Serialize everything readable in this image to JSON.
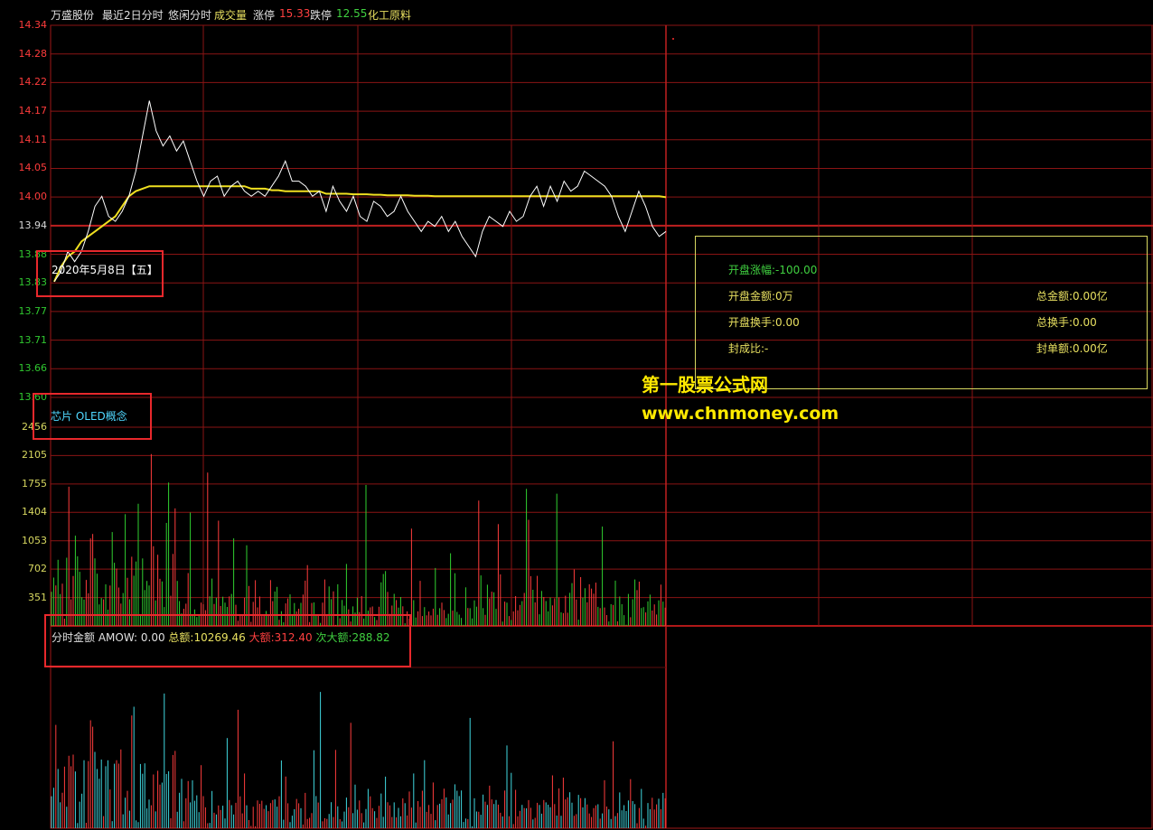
{
  "header": {
    "stock_name": "万盛股份",
    "mode": "最近2日分时",
    "mode2": "悠闲分时",
    "volume_label": "成交量",
    "limit_up_label": "涨停",
    "limit_up": "15.33",
    "limit_down_label": "跌停",
    "limit_down": "12.55",
    "industry": "化工原料"
  },
  "date_label": "2020年5月8日【五】",
  "concept_label": "芯片 OLED概念",
  "price_axis": [
    "14.34",
    "14.28",
    "14.22",
    "14.17",
    "14.11",
    "14.05",
    "14.00",
    "13.94",
    "13.88",
    "13.83",
    "13.77",
    "13.71",
    "13.66",
    "13.60"
  ],
  "volume_axis": [
    "2456",
    "2105",
    "1755",
    "1404",
    "1053",
    "702",
    "351"
  ],
  "amount_indicator": {
    "name": "分时金额",
    "amow": "AMOW: 0.00",
    "total_label": "总额:",
    "total": "10269.46",
    "big_label": "大额:",
    "big": "312.40",
    "second_label": "次大额:",
    "second": "288.82"
  },
  "info_panel": {
    "open_change_label": "开盘涨幅:",
    "open_change": "-100.00",
    "open_amount_label": "开盘金额:",
    "open_amount": "0万",
    "open_turnover_label": "开盘换手:",
    "open_turnover": "0.00",
    "seal_ratio_label": "封成比:",
    "seal_ratio": "-",
    "total_amount_label": "总金额:",
    "total_amount": "0.00亿",
    "total_turnover_label": "总换手:",
    "total_turnover": "0.00",
    "seal_amount_label": "封单额:",
    "seal_amount": "0.00亿"
  },
  "watermark": {
    "title": "第一股票公式网",
    "url": "www.chnmoney.com"
  },
  "chart_data": {
    "type": "line",
    "ylim": [
      13.6,
      14.34
    ],
    "price": [
      13.83,
      13.85,
      13.89,
      13.87,
      13.89,
      13.93,
      13.98,
      14.0,
      13.96,
      13.95,
      13.97,
      14.0,
      14.05,
      14.12,
      14.19,
      14.13,
      14.1,
      14.12,
      14.09,
      14.11,
      14.07,
      14.03,
      14.0,
      14.03,
      14.04,
      14.0,
      14.02,
      14.03,
      14.01,
      14.0,
      14.01,
      14.0,
      14.02,
      14.04,
      14.07,
      14.03,
      14.03,
      14.02,
      14.0,
      14.01,
      13.97,
      14.02,
      13.99,
      13.97,
      14.0,
      13.96,
      13.95,
      13.99,
      13.98,
      13.96,
      13.97,
      14.0,
      13.97,
      13.95,
      13.93,
      13.95,
      13.94,
      13.96,
      13.93,
      13.95,
      13.92,
      13.9,
      13.88,
      13.93,
      13.96,
      13.95,
      13.94,
      13.97,
      13.95,
      13.96,
      14.0,
      14.02,
      13.98,
      14.02,
      13.99,
      14.03,
      14.01,
      14.02,
      14.05,
      14.04,
      14.03,
      14.02,
      14.0,
      13.96,
      13.93,
      13.97,
      14.01,
      13.98,
      13.94,
      13.92,
      13.93
    ],
    "avg": [
      13.83,
      13.86,
      13.88,
      13.89,
      13.91,
      13.92,
      13.93,
      13.94,
      13.95,
      13.96,
      13.98,
      14.0,
      14.01,
      14.015,
      14.02,
      14.02,
      14.02,
      14.02,
      14.02,
      14.02,
      14.02,
      14.02,
      14.02,
      14.02,
      14.02,
      14.02,
      14.02,
      14.02,
      14.02,
      14.015,
      14.015,
      14.015,
      14.012,
      14.012,
      14.01,
      14.01,
      14.01,
      14.01,
      14.01,
      14.01,
      14.005,
      14.005,
      14.005,
      14.005,
      14.004,
      14.004,
      14.004,
      14.003,
      14.003,
      14.002,
      14.002,
      14.002,
      14.002,
      14.001,
      14.001,
      14.001,
      14.0,
      14.0,
      14.0,
      14.0,
      14.0,
      14.0,
      14.0,
      14.0,
      14.0,
      14.0,
      14.0,
      14.0,
      14.0,
      14.0,
      14.0,
      14.0,
      14.0,
      14.0,
      14.0,
      14.0,
      14.0,
      14.0,
      14.0,
      14.0,
      14.0,
      14.0,
      14.0,
      14.0,
      14.0,
      14.0,
      14.0,
      14.0,
      14.0,
      14.0,
      13.998
    ]
  }
}
